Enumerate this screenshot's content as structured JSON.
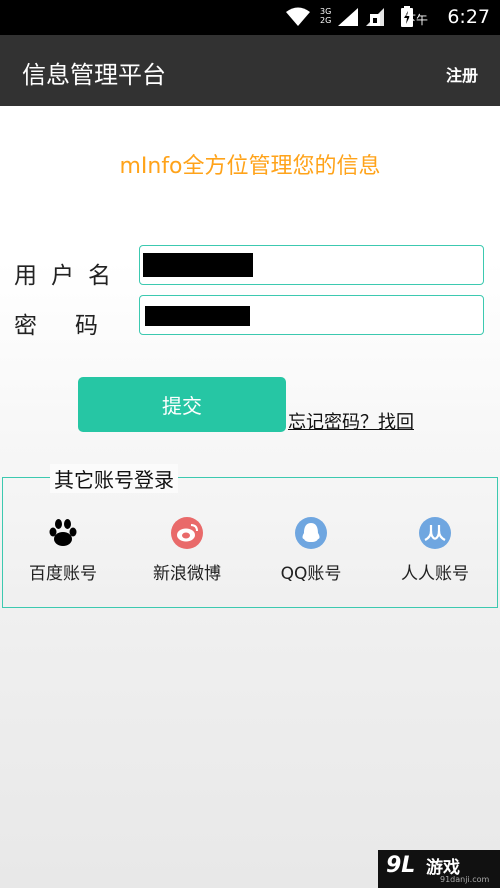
{
  "status": {
    "ampm": "下午",
    "time": "6:27",
    "network_top": "3G",
    "network_bottom": "2G",
    "icons": [
      "wifi-icon",
      "signal-icon",
      "sim-icon",
      "battery-charging-icon"
    ]
  },
  "app_bar": {
    "title": "信息管理平台",
    "register_label": "注册"
  },
  "slogan": "mInfo全方位管理您的信息",
  "form": {
    "username_label": "用户名",
    "password_label": "密码"
  },
  "submit_label": "提交",
  "forgot_label": "忘记密码？找回",
  "other_accounts": {
    "title": "其它账号登录",
    "items": [
      {
        "label": "百度账号",
        "icon": "baidu-paw-icon"
      },
      {
        "label": "新浪微博",
        "icon": "weibo-icon"
      },
      {
        "label": "QQ账号",
        "icon": "qq-penguin-icon"
      },
      {
        "label": "人人账号",
        "icon": "renren-icon"
      }
    ]
  },
  "watermark": {
    "logo": "9L",
    "text": "游戏",
    "sub": "91danji.com"
  },
  "colors": {
    "accent": "#26c6a4",
    "border": "#3cc9b0",
    "slogan": "#ffa31a",
    "app_bar": "#323232"
  }
}
